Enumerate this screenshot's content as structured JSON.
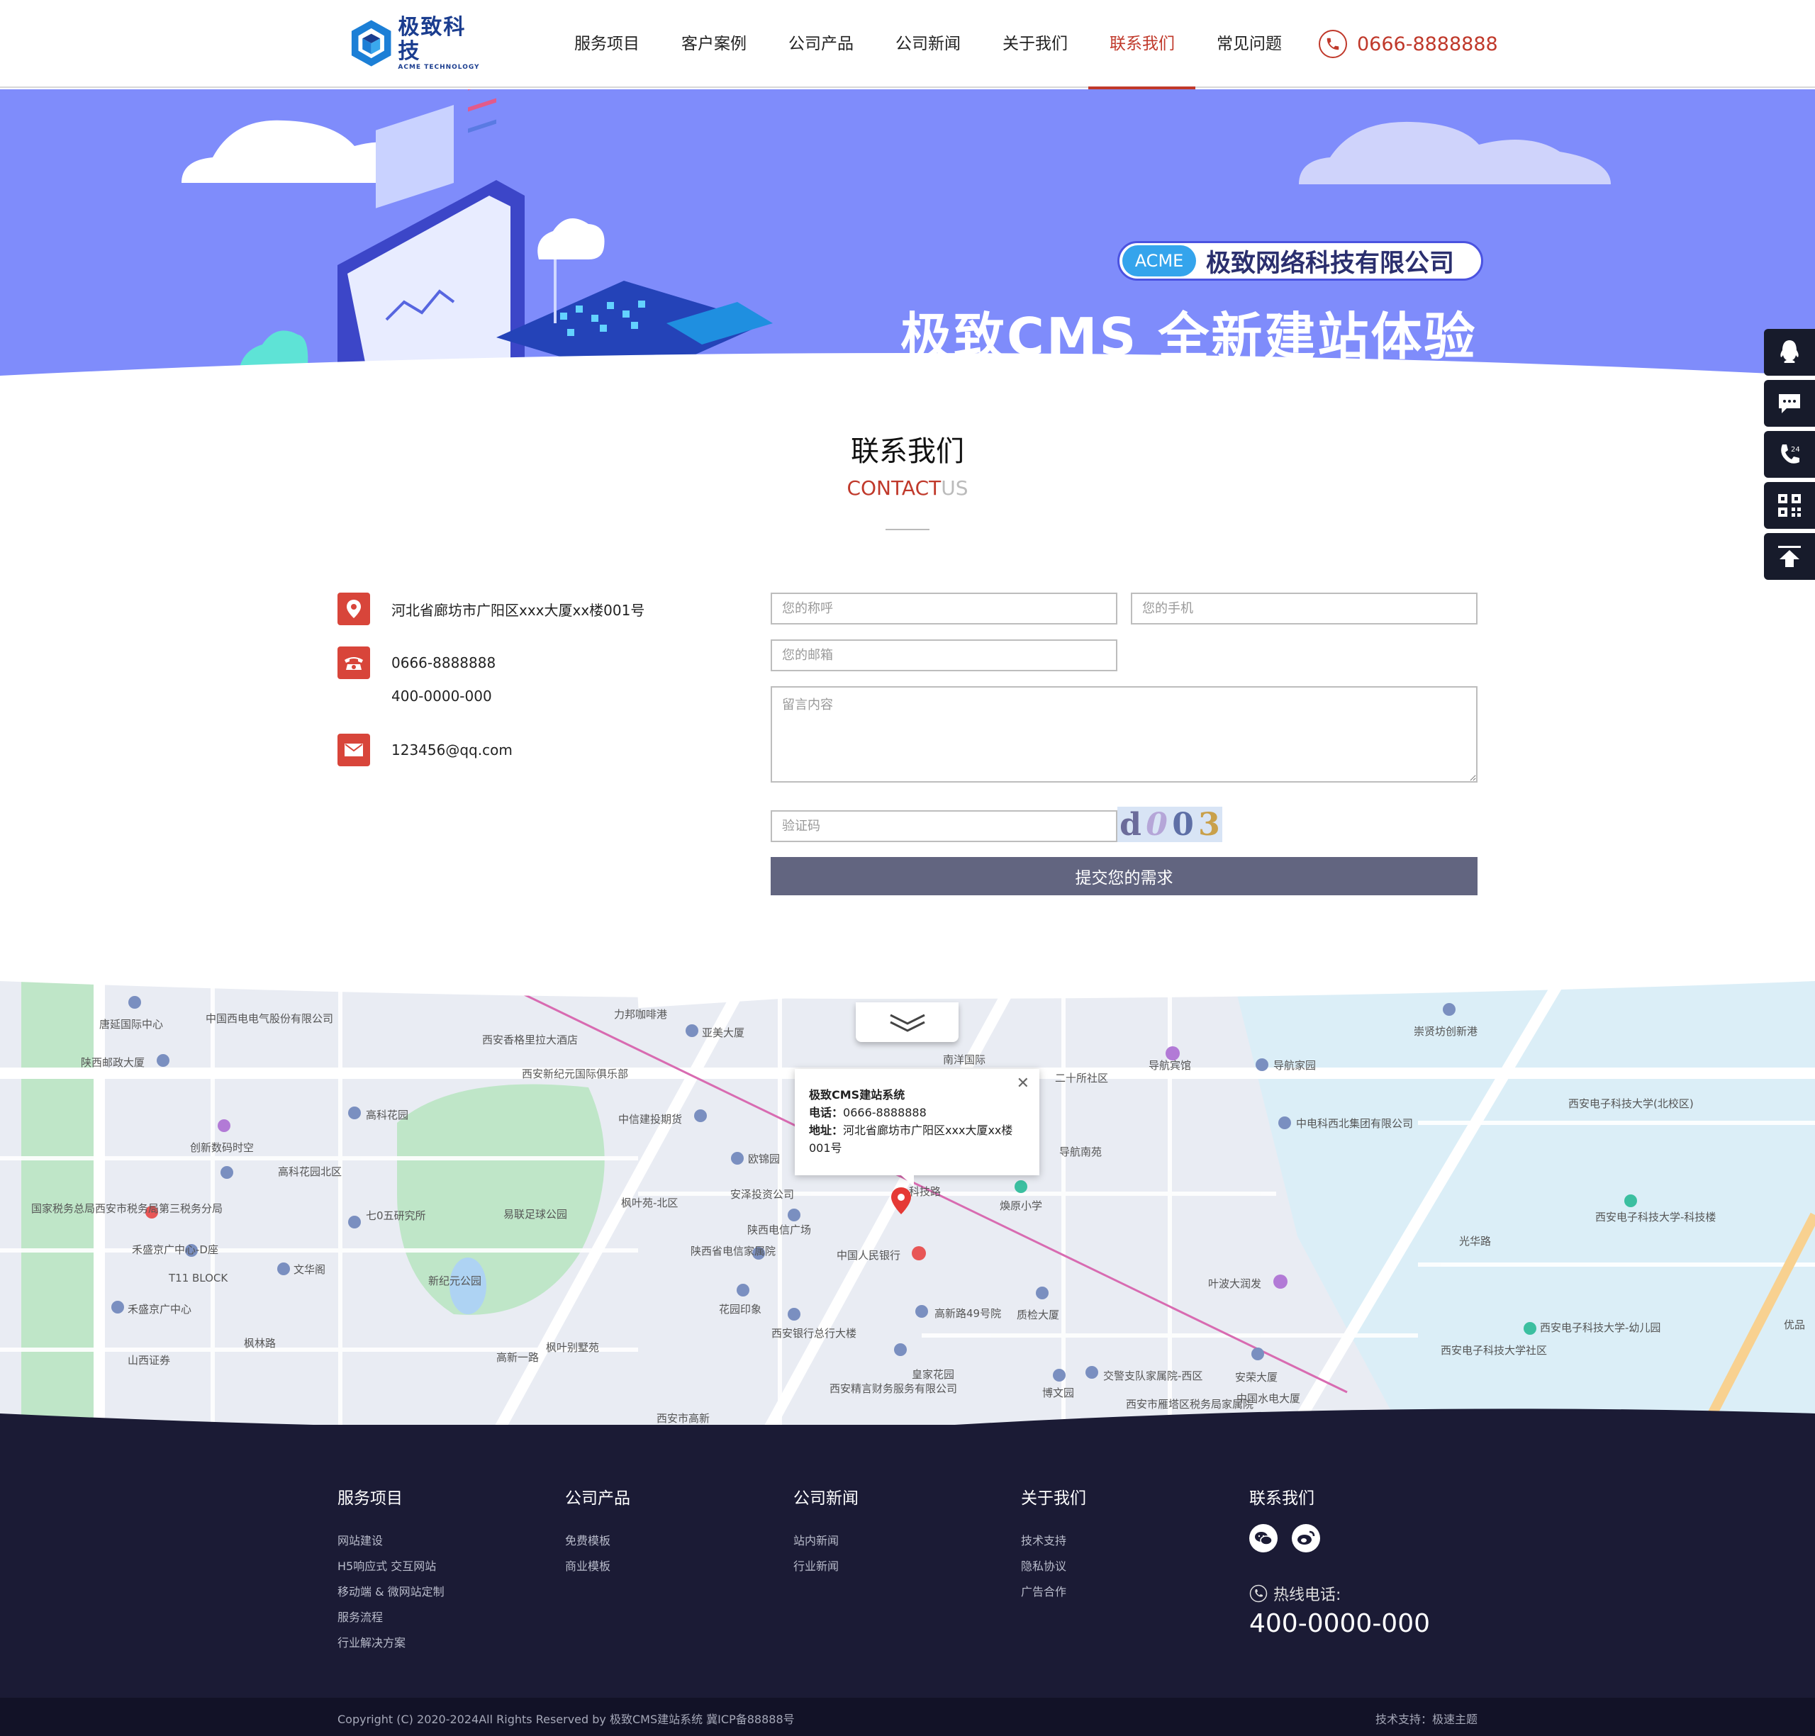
{
  "header": {
    "logo_cn": "极致科技",
    "logo_en": "ACME TECHNOLOGY",
    "nav": [
      {
        "label": "服务项目"
      },
      {
        "label": "客户案例"
      },
      {
        "label": "公司产品"
      },
      {
        "label": "公司新闻"
      },
      {
        "label": "关于我们"
      },
      {
        "label": "联系我们"
      },
      {
        "label": "常见问题"
      }
    ],
    "active_nav": "联系我们",
    "phone": "0666-8888888"
  },
  "banner": {
    "badge_acme": "ACME",
    "company": "极致网络科技有限公司",
    "slogan": "极致CMS 全新建站体验"
  },
  "section": {
    "title": "联系我们",
    "sub_red": "CONTACT",
    "sub_gray": "US"
  },
  "contact": {
    "address": "河北省廊坊市广阳区xxx大厦xx楼001号",
    "phone1": "0666-8888888",
    "phone2": "400-0000-000",
    "email": "123456@qq.com"
  },
  "form": {
    "name_placeholder": "您的称呼",
    "mobile_placeholder": "您的手机",
    "email_placeholder": "您的邮箱",
    "message_placeholder": "留言内容",
    "captcha_placeholder": "验证码",
    "captcha_chars": [
      "d",
      "0",
      "0",
      "3"
    ],
    "submit_label": "提交您的需求"
  },
  "map": {
    "popup_title": "极致CMS建站系统",
    "popup_phone_label": "电话",
    "popup_phone": "0666-8888888",
    "popup_addr_label": "地址",
    "popup_addr": "河北省廊坊市广阳区xxx大厦xx楼001号",
    "labels": [
      "唐延国际中心",
      "中国西电电气股份有限公司",
      "西安香格里拉大酒店",
      "力邦咖啡港",
      "亚美大厦",
      "西安新纪元国际俱乐部",
      "陕西邮政大厦",
      "高科花园",
      "创新数码时空",
      "高科花园北区",
      "中信建投期货",
      "南洋国际",
      "二十所社区",
      "导航宾馆",
      "导航家园",
      "崇贤坊创新港",
      "欧锦园",
      "中电科西北集团有限公司",
      "导航南苑",
      "枫叶苑-北区",
      "安泽投资公司",
      "科技路",
      "煥原小学",
      "陕西电信广场",
      "陕西省电信家属院",
      "中国人民银行",
      "易联足球公园",
      "七0五研究所",
      "禾盛京广中心-D座",
      "T11 BLOCK",
      "文华阁",
      "新纪元公园",
      "叶波大润发",
      "光华路",
      "西安电子科技大学(北校区)",
      "西安电子科技大学-科技楼",
      "国家税务总局西安市税务局第三税务分局",
      "禾盛京广中心",
      "花园印象",
      "高新路49号院",
      "质检大厦",
      "西安银行总行大楼",
      "枫叶别墅苑",
      "皇家花园",
      "博文园",
      "交警支队家属院-西区",
      "安荣大厦",
      "山西证券",
      "西安精言财务服务有限公司",
      "西安市雁塔区税务局家属院",
      "中国水电大厦",
      "西安电子科技大学社区",
      "西安电子科技大学-幼儿园",
      "优品",
      "高新一路",
      "枫林路",
      "西安市高新"
    ]
  },
  "footer": {
    "cols": [
      {
        "title": "服务项目",
        "links": [
          "网站建设",
          "H5响应式 交互网站",
          "移动端 & 微网站定制",
          "服务流程",
          "行业解决方案"
        ]
      },
      {
        "title": "公司产品",
        "links": [
          "免费模板",
          "商业模板"
        ]
      },
      {
        "title": "公司新闻",
        "links": [
          "站内新闻",
          "行业新闻"
        ]
      },
      {
        "title": "关于我们",
        "links": [
          "技术支持",
          "隐私协议",
          "广告合作"
        ]
      }
    ],
    "contact_title": "联系我们",
    "hotline_label": "热线电话:",
    "hotline": "400-0000-000",
    "copyright": "Copyright (C) 2020-2024All Rights Reserved by 极致CMS建站系统 冀ICP备88888号",
    "support": "技术支持：极速主题"
  },
  "sidebar": {
    "icons": [
      "qq-icon",
      "message-icon",
      "phone-24-icon",
      "qrcode-icon",
      "back-to-top-icon"
    ]
  },
  "colors": {
    "accent": "#c0392b",
    "banner": "#7f8cfb",
    "footer": "#1b1b35",
    "submit": "#626580"
  }
}
